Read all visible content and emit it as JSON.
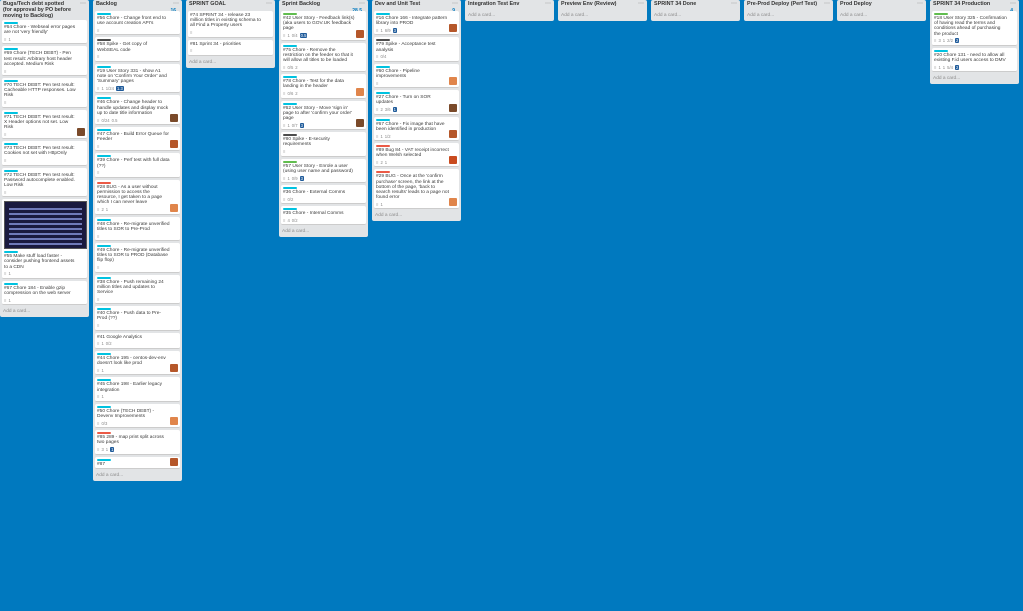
{
  "board": {
    "lists": [
      {
        "title": "Bugs/Tech debt spotted (for approval by PO before moving to Backlog)",
        "count": "",
        "add_card": "Add a card...",
        "cards": [
          {
            "title": "#64 Chore - Webseal error pages are not 'very friendly'",
            "label": "#00c2e0",
            "badges": [
              "",
              "1"
            ]
          },
          {
            "title": "#69 Chore (TECH DEBT) - Pen test result: Arbitrary host header accepted. Medium Risk",
            "label": "#00c2e0",
            "badges": [
              ""
            ]
          },
          {
            "title": "#70 TECH DEBT: Pen test result: Cacheable HTTP responses. Low Risk",
            "label": "#00c2e0",
            "badges": [
              ""
            ]
          },
          {
            "title": "#71 TECH DEBT: Pen test result: X Header options not set. Low Risk",
            "label": "#00c2e0",
            "badges": [
              ""
            ]
          },
          {
            "title": "#73 TECH DEBT: Pen test result: Cookies not set with HttpOnly",
            "label": "#00c2e0",
            "badges": [
              ""
            ]
          },
          {
            "title": "#72 TECH DEBT: Pen test result: Password autocomplete enabled. Low Risk",
            "label": "#00c2e0",
            "badges": [
              ""
            ]
          },
          {
            "title": "#55 Make stuff load faster - consider pushing frontend assets to a CDN",
            "label": "#00c2e0",
            "badges": [
              "1"
            ],
            "thumb": true
          },
          {
            "title": "#67 Chore 184 - Enable gzip compression on the web server",
            "label": "#00c2e0",
            "badges": [
              "1"
            ]
          }
        ]
      },
      {
        "title": "Backlog",
        "count": "16",
        "add_card": "Add a card...",
        "cards": [
          {
            "title": "#56 Chore - Change front end to use account creation API's",
            "label": "#00c2e0",
            "badges": [
              ""
            ]
          },
          {
            "title": "#58 Spike - Get copy of WebSEAL code",
            "label": "#4d4d4d",
            "badges": [
              ""
            ]
          },
          {
            "title": "#19 User Story 331 - show A1 note on 'Confirm Your Order' and 'Summary' pages",
            "label": "#00c2e0",
            "badges": [
              "1",
              "1/24",
              "1.3"
            ]
          },
          {
            "title": "#46 Chore - Change header to handle updates and display mock up to date title information",
            "label": "#00c2e0",
            "badges": [
              "0/24",
              "0.5"
            ]
          },
          {
            "title": "#47 Chore - Build Error Queue for Feeder",
            "label": "#00c2e0",
            "badges": [
              ""
            ]
          },
          {
            "title": "#39 Chore - Perf test with full data (??)",
            "label": "#00c2e0",
            "badges": [
              ""
            ]
          },
          {
            "title": "#28 BUG - As a user without permission to access the resource, I get taken to a page which I can never leave",
            "label": "#eb5a46",
            "badges": [
              "2",
              "1"
            ]
          },
          {
            "title": "#48 Chore - Re-migrate unverified titles to SOR to Pre-Prod",
            "label": "#00c2e0",
            "badges": [
              ""
            ]
          },
          {
            "title": "#49 Chore - Re-migrate unverified titles to SOR to PROD (Database flip flop)",
            "label": "#00c2e0",
            "badges": [
              ""
            ]
          },
          {
            "title": "#38 Chore - Push remaining 24 million titles and updates to Service",
            "label": "#00c2e0",
            "badges": [
              ""
            ]
          },
          {
            "title": "#40 Chore - Push data to Pre-Prod (??)",
            "label": "#00c2e0",
            "badges": [
              ""
            ]
          },
          {
            "title": "#41 Google Analytics",
            "label": "",
            "badges": [
              "1",
              "0/2"
            ]
          },
          {
            "title": "#44 Chore 195 - centos-dev-env doesn't look like prod",
            "label": "#00c2e0",
            "badges": [
              "1"
            ]
          },
          {
            "title": "#45 Chore 198 - Earlier legacy integration",
            "label": "#00c2e0",
            "badges": [
              "1"
            ]
          },
          {
            "title": "#50 Chore (TECH DEBT) - Devenv Improvements",
            "label": "#00c2e0",
            "badges": [
              "0/3"
            ]
          },
          {
            "title": "#85 289 - map print split across two pages",
            "label": "#eb5a46",
            "badges": [
              "3",
              "1",
              "1"
            ]
          },
          {
            "title": "#87",
            "label": "#00c2e0",
            "badges": []
          }
        ]
      },
      {
        "title": "SPRINT GOAL",
        "count": "",
        "add_card": "Add a card...",
        "cards": [
          {
            "title": "#74 SPRINT 34 - release 23 million titles in existing schema to all Find a Property users",
            "label": "",
            "badges": [
              ""
            ]
          },
          {
            "title": "#81 Sprint 34 - priorities",
            "label": "",
            "badges": [
              ""
            ]
          }
        ]
      },
      {
        "title": "Sprint Backlog",
        "count": "28.5",
        "add_card": "Add a card...",
        "cards": [
          {
            "title": "#42 User Story - Feedback link(s) (aka users to GOV.UK feedback page",
            "label": "#61bd4f",
            "badges": [
              "1",
              "0/4",
              "0.5"
            ]
          },
          {
            "title": "#75 Chore - Remove the restriction on the feeder so that it will allow all titles to be loaded",
            "label": "#00c2e0",
            "badges": [
              "0/5",
              "2"
            ]
          },
          {
            "title": "#78 Chore - Test for the data landing in the header",
            "label": "#00c2e0",
            "badges": [
              "0/6",
              "2"
            ]
          },
          {
            "title": "#62 User Story - Move 'sign in' page to after 'confirm your order' page",
            "label": "#00c2e0",
            "badges": [
              "1",
              "0/7",
              "3"
            ]
          },
          {
            "title": "#80 Spike - E-security requirements",
            "label": "#4d4d4d",
            "badges": [
              ""
            ]
          },
          {
            "title": "#57 User Story - Enrole a user (using user name and password)",
            "label": "#61bd4f",
            "badges": [
              "1",
              "0/9",
              "3"
            ]
          },
          {
            "title": "#36 Chore - External Comms",
            "label": "#00c2e0",
            "badges": [
              "",
              "0/2"
            ]
          },
          {
            "title": "#35 Chore - Internal Comms",
            "label": "#00c2e0",
            "badges": [
              "4",
              "0/2"
            ]
          }
        ]
      },
      {
        "title": "Dev and Unit Test",
        "count": "9",
        "add_card": "Add a card...",
        "cards": [
          {
            "title": "#16 Chore 166 - Integrate pattern library into PROD",
            "label": "#00c2e0",
            "badges": [
              "1",
              "6/9",
              "3"
            ]
          },
          {
            "title": "#79 Spike - Acceptance test analysis",
            "label": "#4d4d4d",
            "badges": [
              "0/4"
            ]
          },
          {
            "title": "#60 Chore - Pipeline improvements",
            "label": "#00c2e0",
            "badges": [
              ""
            ]
          },
          {
            "title": "#27 Chore - Turn on SOR updates",
            "label": "#00c2e0",
            "badges": [
              "2",
              "3/6",
              "1"
            ]
          },
          {
            "title": "#67 Chore - Fix image that have been identified in production",
            "label": "#00c2e0",
            "badges": [
              "1",
              "1/2"
            ]
          },
          {
            "title": "#89 Bug 84 - VAT receipt incorrect when Welsh selected",
            "label": "#eb5a46",
            "badges": [
              "2",
              "1"
            ]
          },
          {
            "title": "#29 BUG - Once at the 'confirm purchase' screen, the link at the bottom of the page, 'back to search results' leads to a page not found error",
            "label": "#eb5a46",
            "badges": [
              "1"
            ]
          }
        ]
      },
      {
        "title": "Integration Test Env",
        "count": "",
        "add_card": "Add a card...",
        "cards": []
      },
      {
        "title": "Preview Env (Review)",
        "count": "",
        "add_card": "Add a card...",
        "cards": []
      },
      {
        "title": "SPRINT 34 Done",
        "count": "",
        "add_card": "Add a card...",
        "cards": []
      },
      {
        "title": "Pre-Prod Deploy (Perf Test)",
        "count": "",
        "add_card": "Add a card...",
        "cards": []
      },
      {
        "title": "Prod Deploy",
        "count": "",
        "add_card": "Add a card...",
        "cards": []
      },
      {
        "title": "SPRINT 34 Production",
        "count": "4",
        "add_card": "Add a card...",
        "cards": [
          {
            "title": "#18 User Story 325 - Confirmation of having read the terms and conditions ahead of purchasing the product",
            "label": "#61bd4f",
            "badges": [
              "3",
              "1",
              "2/2",
              "2"
            ]
          },
          {
            "title": "#20 Chore 131 - need to allow all existing F.id users access to DMV",
            "label": "#00c2e0",
            "badges": [
              "1",
              "1",
              "5/4",
              "2"
            ]
          }
        ]
      }
    ]
  }
}
